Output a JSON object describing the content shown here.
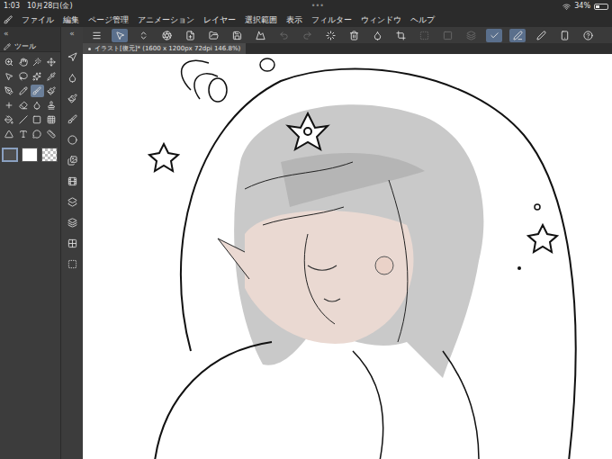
{
  "status_bar": {
    "time": "1:03",
    "date": "10月28日(金)",
    "battery": "34%",
    "battery_level": 0.34
  },
  "multitask": "•••",
  "menu": [
    "ファイル",
    "編集",
    "ページ管理",
    "アニメーション",
    "レイヤー",
    "選択範囲",
    "表示",
    "フィルター",
    "ウィンドウ",
    "ヘルプ"
  ],
  "command_bar": {
    "buttons": [
      {
        "selected": false,
        "disabled": false
      },
      {
        "selected": true,
        "disabled": false
      },
      {
        "selected": false,
        "disabled": false
      },
      {
        "selected": false,
        "disabled": false
      },
      {
        "selected": false,
        "disabled": false
      },
      {
        "selected": false,
        "disabled": false
      },
      {
        "selected": false,
        "disabled": false
      },
      {
        "selected": false,
        "disabled": false
      },
      {
        "selected": false,
        "disabled": true
      },
      {
        "selected": false,
        "disabled": true
      },
      {
        "selected": false,
        "disabled": false
      },
      {
        "selected": false,
        "disabled": false
      },
      {
        "selected": false,
        "disabled": false
      },
      {
        "selected": false,
        "disabled": false
      },
      {
        "selected": false,
        "disabled": true
      },
      {
        "selected": false,
        "disabled": true
      },
      {
        "selected": false,
        "disabled": true
      },
      {
        "selected": true,
        "disabled": false
      },
      {
        "selected": true,
        "disabled": false
      },
      {
        "selected": false,
        "disabled": false
      },
      {
        "selected": false,
        "disabled": false
      },
      {
        "selected": false,
        "disabled": false
      }
    ]
  },
  "panel_collapse": [
    "«",
    "«"
  ],
  "tool_palette": {
    "title": "ツール",
    "tools": [
      {
        "selected": false
      },
      {
        "selected": false
      },
      {
        "selected": false
      },
      {
        "selected": false
      },
      {
        "selected": false
      },
      {
        "selected": false
      },
      {
        "selected": false
      },
      {
        "selected": false
      },
      {
        "selected": false
      },
      {
        "selected": false
      },
      {
        "selected": true
      },
      {
        "selected": false
      },
      {
        "selected": false
      },
      {
        "selected": false
      },
      {
        "selected": false
      },
      {
        "selected": false
      },
      {
        "selected": false
      },
      {
        "selected": false
      },
      {
        "selected": false
      },
      {
        "selected": false
      },
      {
        "selected": false
      },
      {
        "selected": false
      },
      {
        "selected": false
      },
      {
        "selected": false
      }
    ]
  },
  "colors": [
    {
      "kind": "solid",
      "color": "#4d4d4d",
      "selected": true
    },
    {
      "kind": "solid",
      "color": "#ffffff",
      "selected": false
    },
    {
      "kind": "transparent",
      "color": "#ffffff",
      "selected": false
    }
  ],
  "sub_panels": [
    {
      "selected": false
    },
    {
      "selected": false
    },
    {
      "selected": false
    },
    {
      "selected": false
    },
    {
      "selected": false
    },
    {
      "selected": false
    },
    {
      "selected": false
    },
    {
      "selected": false
    },
    {
      "selected": false
    },
    {
      "selected": false
    },
    {
      "selected": false
    }
  ],
  "canvas": {
    "tab": "イラスト[復元]* (1600 x 1200px 72dpi 146.8%)",
    "modified": true
  }
}
